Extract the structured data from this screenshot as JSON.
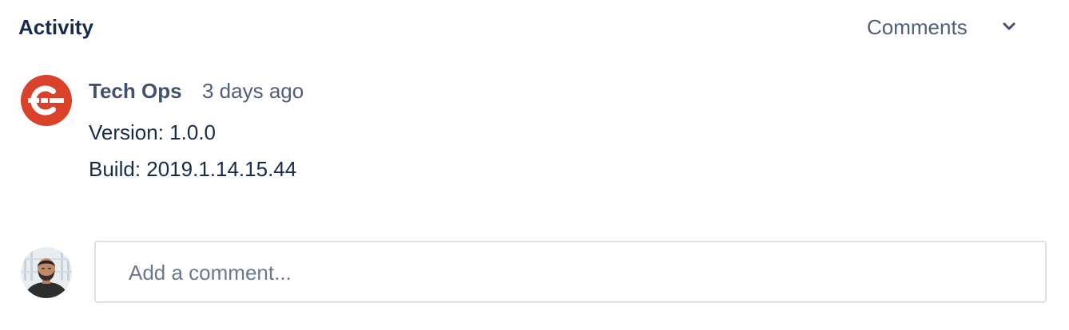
{
  "activity": {
    "title": "Activity",
    "filter": {
      "selected": "Comments",
      "icon": "chevron-down-icon"
    }
  },
  "entries": [
    {
      "author": "Tech Ops",
      "avatar_icon": "ci-bot-logo-icon",
      "avatar_color": "#d9412b",
      "timestamp": "3 days ago",
      "lines": [
        "Version: 1.0.0",
        "Build: 2019.1.14.15.44"
      ]
    }
  ],
  "composer": {
    "placeholder": "Add a comment...",
    "avatar_icon": "user-photo-avatar"
  }
}
